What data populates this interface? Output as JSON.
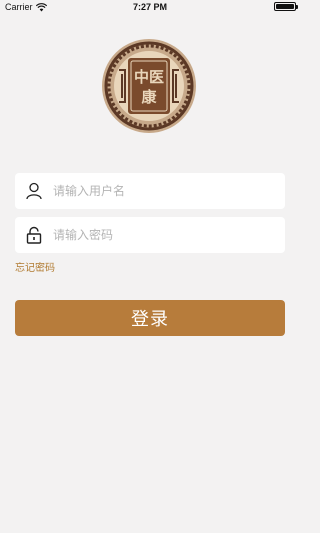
{
  "status_bar": {
    "carrier": "Carrier",
    "time": "7:27 PM",
    "wifi_icon": "wifi-icon",
    "battery_icon": "battery-icon"
  },
  "logo": {
    "text": "中医康",
    "colors": {
      "outer": "#c7a98a",
      "ring": "#5b3825",
      "center": "#7a4a2c",
      "cream": "#e9d6bb"
    }
  },
  "form": {
    "username_placeholder": "请输入用户名",
    "username_value": "",
    "password_placeholder": "请输入密码",
    "password_value": "",
    "forgot_label": "忘记密码",
    "login_label": "登录"
  },
  "icons": {
    "username": "user-icon",
    "password": "lock-icon"
  },
  "colors": {
    "background": "#f3f2f2",
    "accent": "#b77c3b",
    "link": "#b07a2f"
  }
}
